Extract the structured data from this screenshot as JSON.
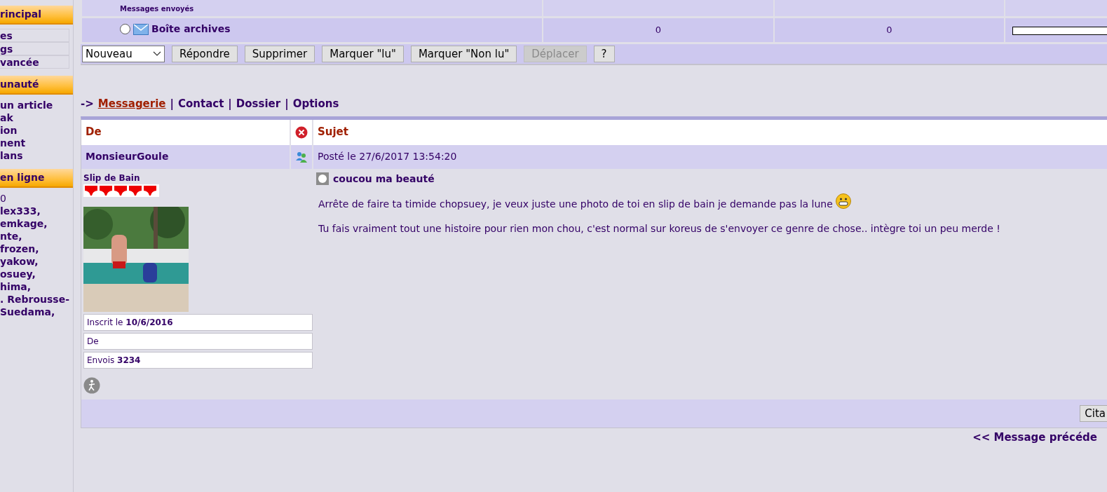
{
  "sidebar": {
    "sections": [
      {
        "title": "rincipal",
        "items": [
          {
            "kind": "box",
            "label": "es"
          },
          {
            "kind": "box",
            "label": "gs"
          },
          {
            "kind": "box",
            "label": "vancée"
          }
        ]
      },
      {
        "title": "unauté",
        "items": [
          {
            "kind": "link",
            "label": "un article"
          },
          {
            "kind": "link",
            "label": "ak"
          },
          {
            "kind": "link",
            "label": "ion"
          },
          {
            "kind": "link",
            "label": "nent"
          },
          {
            "kind": "link",
            "label": "lans"
          }
        ]
      },
      {
        "title": "en ligne",
        "items": [
          {
            "kind": "count",
            "label": "0"
          },
          {
            "kind": "link",
            "label": "lex333,"
          },
          {
            "kind": "link",
            "label": "emkage,"
          },
          {
            "kind": "link",
            "label": "nte,"
          },
          {
            "kind": "link",
            "label": "frozen,"
          },
          {
            "kind": "link",
            "label": "yakow,"
          },
          {
            "kind": "link",
            "label": "osuey,"
          },
          {
            "kind": "link",
            "label": "hima,"
          },
          {
            "kind": "link",
            "label": ". Rebrousse-"
          },
          {
            "kind": "link",
            "label": "Suedama,"
          }
        ]
      }
    ]
  },
  "folders": [
    {
      "name": "Messages envoyés"
    },
    {
      "name": "Boîte archives",
      "selected": false,
      "cells": [
        "0",
        "0"
      ],
      "level": 0
    }
  ],
  "toolbar": {
    "select": "Nouveau",
    "buttons": [
      {
        "label": "Répondre",
        "disabled": false
      },
      {
        "label": "Supprimer",
        "disabled": false
      },
      {
        "label": "Marquer \"lu\"",
        "disabled": false
      },
      {
        "label": "Marquer \"Non lu\"",
        "disabled": false
      },
      {
        "label": "Déplacer",
        "disabled": true
      },
      {
        "label": "?",
        "disabled": false
      }
    ]
  },
  "breadcrumb": {
    "prefix": "->",
    "separator": "|",
    "links": [
      {
        "label": "Messagerie",
        "selected": true
      },
      {
        "label": "Contact",
        "selected": false
      },
      {
        "label": "Dossier",
        "selected": false
      },
      {
        "label": "Options",
        "selected": false
      }
    ]
  },
  "message": {
    "col_from": "De",
    "col_subject": "Sujet",
    "author": "MonsieurGoule",
    "posted": "Posté le 27/6/2017 13:54:20",
    "rank": "Slip de Bain",
    "avatar": {
      "kind": "picture"
    },
    "info": [
      "Inscrit le **10/6/2016**",
      "De",
      "Envois **3234**"
    ],
    "subject": "coucou ma beauté",
    "paragraphs": [
      "Arrête de faire ta timide chopsuey, je veux juste une photo de toi en slip de bain je demande pas la lune",
      "Tu fais vraiment tout une histoire pour rien mon chou, c'est normal sur koreus de s'envoyer ce genre de chose.. intègre toi un peu merde !"
    ],
    "quote_button": "Cita",
    "previous": "<< Message précéde"
  }
}
